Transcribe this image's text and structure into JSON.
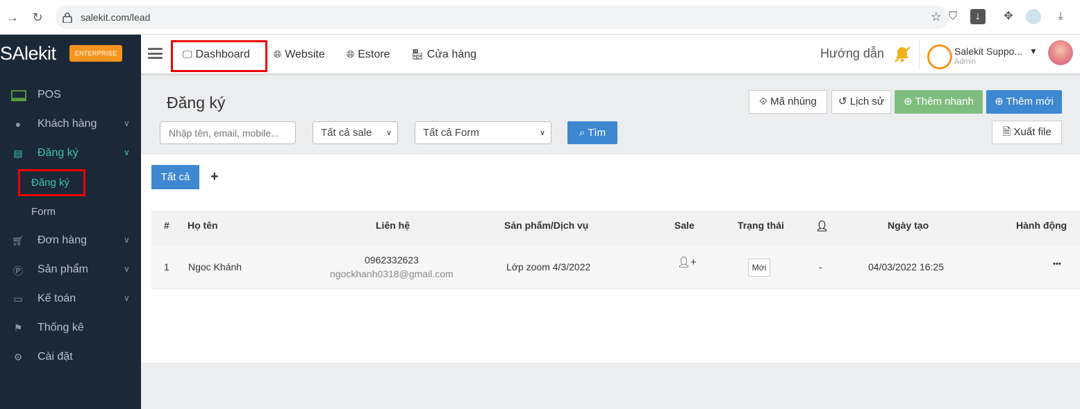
{
  "browser": {
    "url": "salekit.com/lead"
  },
  "brand": {
    "logo_text": "SAlekit",
    "edition": "ENTERPRISE"
  },
  "sidebar": {
    "items": [
      {
        "label": "POS"
      },
      {
        "label": "Khách hàng"
      },
      {
        "label": "Đăng ký"
      },
      {
        "label": "Đơn hàng"
      },
      {
        "label": "Sản phẩm"
      },
      {
        "label": "Kế toán"
      },
      {
        "label": "Thống kê"
      },
      {
        "label": "Cài đặt"
      }
    ],
    "subitems": [
      {
        "label": "Đăng ký"
      },
      {
        "label": "Form"
      }
    ]
  },
  "topnav": {
    "items": [
      {
        "label": "Dashboard"
      },
      {
        "label": "Website"
      },
      {
        "label": "Estore"
      },
      {
        "label": "Cửa hàng"
      }
    ],
    "help": "Hướng dẫn",
    "user_name": "Salekit Suppo...",
    "user_role": "Admin"
  },
  "page": {
    "title": "Đăng ký",
    "buttons": {
      "embed": "Mã nhúng",
      "history": "Lịch sử",
      "quick_add": "Thêm nhanh",
      "add_new": "Thêm mới",
      "export": "Xuất file",
      "search": "Tìm"
    },
    "search_placeholder": "Nhập tên, email, mobile...",
    "sale_filter": "Tất cả sale",
    "form_filter": "Tất cả Form"
  },
  "tabs": {
    "all": "Tất cả",
    "add": "+"
  },
  "table": {
    "headers": {
      "index": "#",
      "name": "Họ tên",
      "contact": "Liên hệ",
      "product": "Sản phẩm/Dịch vụ",
      "sale": "Sale",
      "status": "Trạng thái",
      "created": "Ngày tạo",
      "action": "Hành động"
    },
    "rows": [
      {
        "index": "1",
        "name": "Ngoc Khánh",
        "phone": "0962332623",
        "email": "ngockhanh0318@gmail.com",
        "product": "Lớp zoom 4/3/2022",
        "status": "Mới",
        "assignee": "-",
        "created": "04/03/2022 16:25",
        "action": "•••"
      }
    ]
  }
}
